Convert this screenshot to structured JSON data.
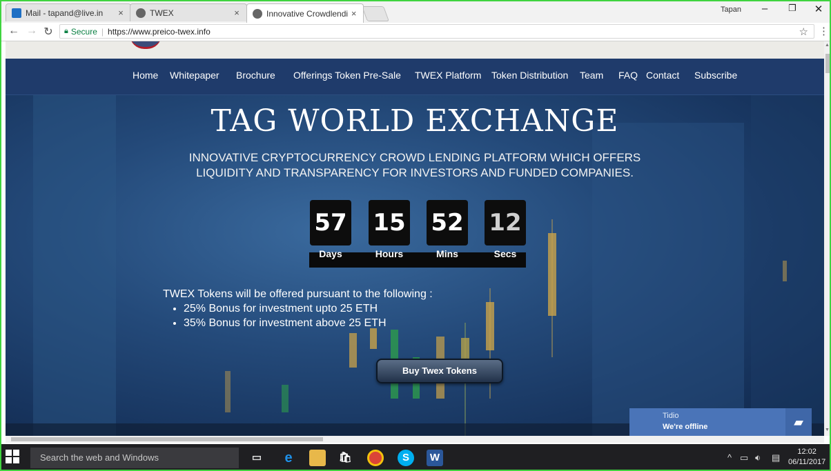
{
  "browser": {
    "tabs": [
      {
        "title": "Mail - tapand@live.in",
        "favicon": "outlook-icon",
        "color": "#1e6fc4"
      },
      {
        "title": "TWEX",
        "favicon": "globe-icon",
        "color": "#555555"
      },
      {
        "title": "Innovative Crowdlending",
        "favicon": "globe-icon",
        "color": "#555555"
      }
    ],
    "close_glyph": "×",
    "profile_name": "Tapan",
    "secure_label": "Secure",
    "url": "https://www.preico-twex.info"
  },
  "nav": {
    "items": [
      "Home",
      "Whitepaper",
      "Brochure",
      "Offerings Token Pre-Sale",
      "TWEX Platform",
      "Token Distribution",
      "Team",
      "FAQ",
      "Contact",
      "Subscribe"
    ]
  },
  "hero": {
    "title": "TAG WORLD EXCHANGE",
    "subtitle_line1": "INNOVATIVE CRYPTOCURRENCY CROWD LENDING PLATFORM WHICH OFFERS",
    "subtitle_line2": "LIQUIDITY AND TRANSPARENCY FOR INVESTORS AND FUNDED COMPANIES."
  },
  "countdown": [
    {
      "value": "57",
      "label": "Days"
    },
    {
      "value": "15",
      "label": "Hours"
    },
    {
      "value": "52",
      "label": "Mins"
    },
    {
      "value": "12",
      "label": "Secs"
    }
  ],
  "offer": {
    "intro": "TWEX Tokens will be offered  pursuant to the following :",
    "bullets": [
      "25% Bonus for investment upto 25 ETH",
      "35% Bonus for investment above 25 ETH"
    ]
  },
  "cta_label": "Buy Twex Tokens",
  "chat_widget": {
    "name": "Tidio",
    "status": "We're offline"
  },
  "taskbar": {
    "search_placeholder": "Search the web and Windows",
    "time": "12:02",
    "date": "06/11/2017"
  }
}
